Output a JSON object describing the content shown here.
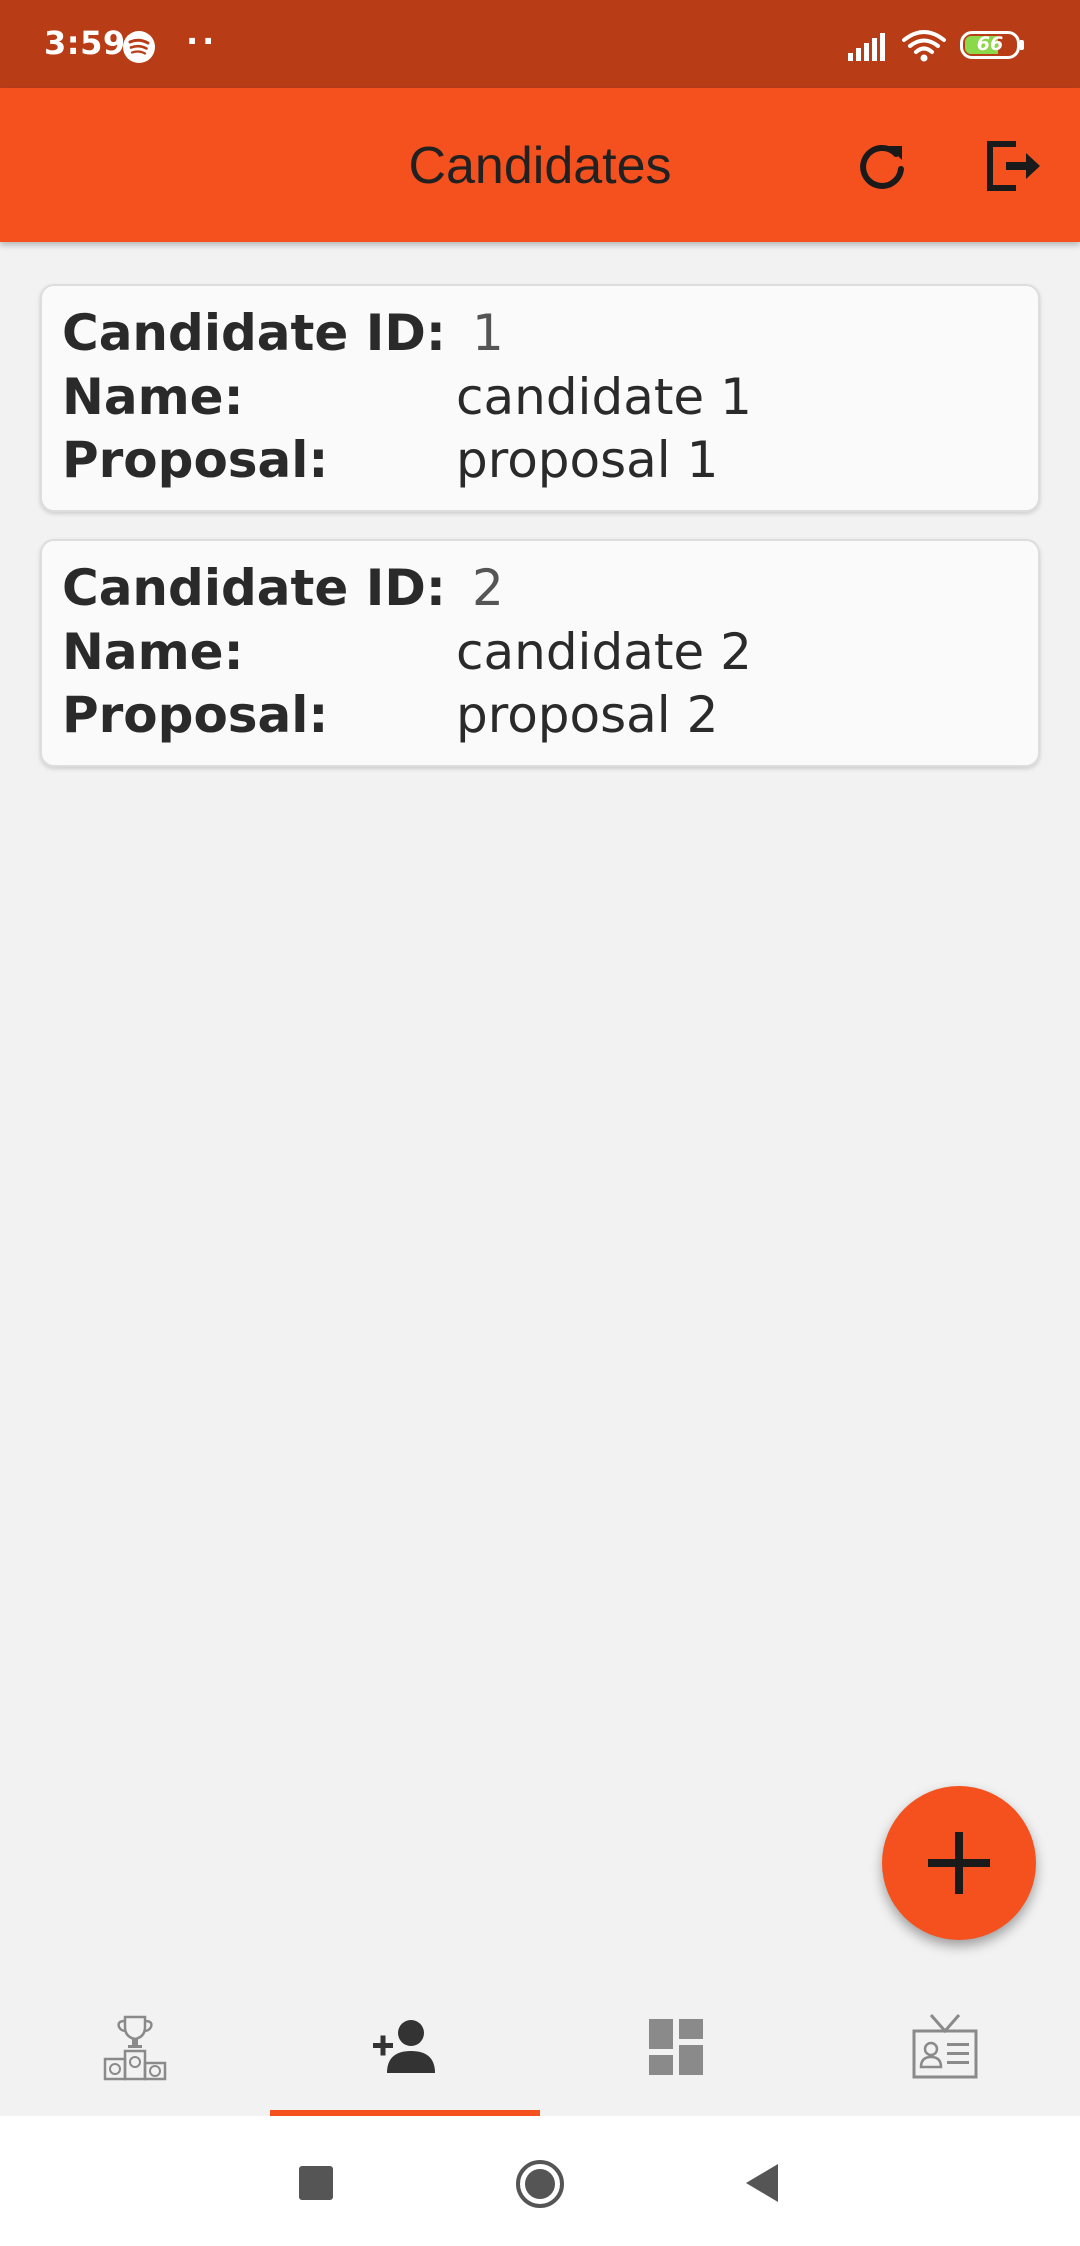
{
  "status_bar": {
    "time": "3:59",
    "dots": "··",
    "battery": "66",
    "icons": [
      "spotify-icon",
      "signal-icon",
      "wifi-icon",
      "battery-icon"
    ]
  },
  "app_bar": {
    "title": "Candidates",
    "actions": [
      "refresh-icon",
      "logout-icon"
    ]
  },
  "candidates": [
    {
      "id_label": "Candidate ID:",
      "id": "1",
      "name_label": "Name:",
      "name": "candidate 1",
      "proposal_label": "Proposal:",
      "proposal": "proposal 1"
    },
    {
      "id_label": "Candidate ID:",
      "id": "2",
      "name_label": "Name:",
      "name": "candidate 2",
      "proposal_label": "Proposal:",
      "proposal": "proposal 2"
    }
  ],
  "fab": {
    "icon": "plus-icon"
  },
  "bottom_nav": {
    "items": [
      "podium-icon",
      "add-person-icon",
      "dashboard-icon",
      "id-badge-icon"
    ],
    "selected_index": 1
  },
  "system_nav": {
    "buttons": [
      "recents-icon",
      "home-icon",
      "back-icon"
    ]
  },
  "colors": {
    "status_bar": "#b83d17",
    "primary": "#f4511e",
    "background": "#f2f2f2",
    "card": "#fafafa",
    "text": "#2a2a2a",
    "nav_icon": "#8a8a8a",
    "nav_icon_active": "#333333"
  }
}
